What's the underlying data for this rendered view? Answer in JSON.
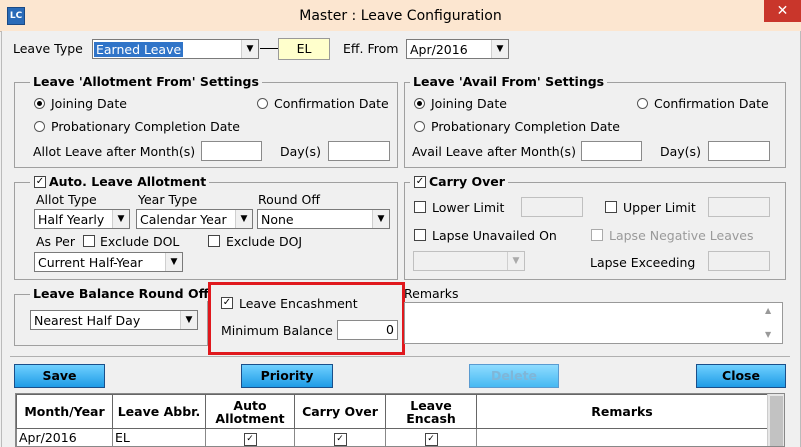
{
  "window": {
    "title": "Master : Leave Configuration",
    "app_icon_text": "LC",
    "close_glyph": "✕"
  },
  "header": {
    "leave_type_label": "Leave Type",
    "leave_type_value": "Earned Leave",
    "leave_abbr": "EL",
    "eff_from_label": "Eff. From",
    "eff_from_value": "Apr/2016"
  },
  "allotment_from": {
    "title": "Leave 'Allotment From' Settings",
    "opt_joining": "Joining Date",
    "opt_confirmation": "Confirmation Date",
    "opt_probation": "Probationary Completion Date",
    "after_months_label": "Allot Leave after Month(s)",
    "days_label": "Day(s)",
    "selected": "Joining Date"
  },
  "avail_from": {
    "title": "Leave 'Avail From' Settings",
    "opt_joining": "Joining Date",
    "opt_confirmation": "Confirmation Date",
    "opt_probation": "Probationary Completion Date",
    "after_months_label": "Avail Leave after Month(s)",
    "days_label": "Day(s)",
    "selected": "Joining Date"
  },
  "auto_allotment": {
    "title": "Auto. Leave Allotment",
    "checked": true,
    "allot_type_label": "Allot Type",
    "allot_type_value": "Half Yearly",
    "year_type_label": "Year Type",
    "year_type_value": "Calendar Year",
    "round_off_label": "Round Off",
    "round_off_value": "None",
    "as_per_label": "As Per",
    "exclude_dol_label": "Exclude DOL",
    "exclude_doj_label": "Exclude DOJ",
    "period_value": "Current Half-Year"
  },
  "carry_over": {
    "title": "Carry Over",
    "checked": true,
    "lower_limit_label": "Lower Limit",
    "upper_limit_label": "Upper Limit",
    "lapse_unavailed_label": "Lapse Unavailed On",
    "lapse_negative_label": "Lapse Negative Leaves",
    "lapse_exceeding_label": "Lapse Exceeding"
  },
  "balance_round_off": {
    "title": "Leave Balance Round Off",
    "value": "Nearest Half Day"
  },
  "encashment": {
    "label": "Leave Encashment",
    "checked": true,
    "min_balance_label": "Minimum Balance",
    "min_balance_value": "0"
  },
  "remarks": {
    "label": "Remarks"
  },
  "buttons": {
    "save": "Save",
    "priority": "Priority",
    "delete": "Delete",
    "close": "Close"
  },
  "grid": {
    "headers": [
      "Month/Year",
      "Leave Abbr.",
      "Auto Allotment",
      "Carry Over",
      "Leave Encash",
      "Remarks"
    ],
    "rows": [
      {
        "month_year": "Apr/2016",
        "leave_abbr": "EL",
        "auto_allotment": true,
        "carry_over": true,
        "leave_encash": true,
        "remarks": ""
      }
    ]
  },
  "colors": {
    "title_bar": "#fce6d0",
    "highlight": "#e0181d",
    "button": "#1e9be6",
    "close_button": "#c9362b"
  }
}
